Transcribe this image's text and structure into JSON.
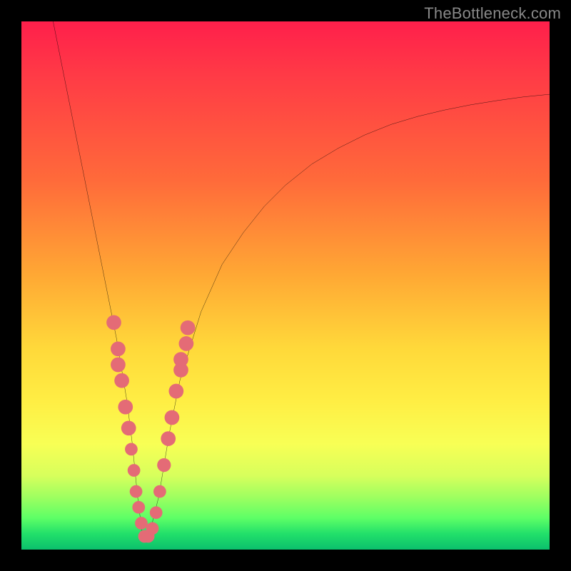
{
  "watermark": "TheBottleneck.com",
  "chart_data": {
    "type": "line",
    "title": "",
    "xlabel": "",
    "ylabel": "",
    "xlim": [
      0,
      100
    ],
    "ylim": [
      0,
      100
    ],
    "series": [
      {
        "name": "bottleneck-curve",
        "x": [
          6,
          8,
          10,
          12,
          14,
          16,
          18,
          20,
          21,
          22,
          23,
          24,
          26,
          28,
          30,
          34,
          38,
          42,
          46,
          50,
          55,
          60,
          65,
          70,
          75,
          80,
          85,
          90,
          95,
          100
        ],
        "values": [
          100,
          90,
          80,
          70,
          60,
          50,
          40,
          28,
          20,
          10,
          2,
          2,
          10,
          22,
          32,
          45,
          54,
          60,
          65,
          69,
          73,
          76,
          78.5,
          80.5,
          82,
          83.2,
          84.2,
          85,
          85.7,
          86.2
        ]
      }
    ],
    "markers": {
      "name": "highlighted-points",
      "color": "#e46b76",
      "points": [
        {
          "x": 17.5,
          "y": 43,
          "r": 1.4
        },
        {
          "x": 18.3,
          "y": 38,
          "r": 1.4
        },
        {
          "x": 18.3,
          "y": 35,
          "r": 1.4
        },
        {
          "x": 19.0,
          "y": 32,
          "r": 1.4
        },
        {
          "x": 19.7,
          "y": 27,
          "r": 1.4
        },
        {
          "x": 20.3,
          "y": 23,
          "r": 1.4
        },
        {
          "x": 20.8,
          "y": 19,
          "r": 1.2
        },
        {
          "x": 21.3,
          "y": 15,
          "r": 1.2
        },
        {
          "x": 21.7,
          "y": 11,
          "r": 1.2
        },
        {
          "x": 22.2,
          "y": 8,
          "r": 1.2
        },
        {
          "x": 22.7,
          "y": 5,
          "r": 1.2
        },
        {
          "x": 23.3,
          "y": 2.5,
          "r": 1.2
        },
        {
          "x": 24.0,
          "y": 2.5,
          "r": 1.2
        },
        {
          "x": 24.8,
          "y": 4,
          "r": 1.2
        },
        {
          "x": 25.5,
          "y": 7,
          "r": 1.2
        },
        {
          "x": 26.2,
          "y": 11,
          "r": 1.2
        },
        {
          "x": 27.0,
          "y": 16,
          "r": 1.3
        },
        {
          "x": 27.8,
          "y": 21,
          "r": 1.4
        },
        {
          "x": 28.5,
          "y": 25,
          "r": 1.4
        },
        {
          "x": 29.3,
          "y": 30,
          "r": 1.4
        },
        {
          "x": 30.2,
          "y": 34,
          "r": 1.4
        },
        {
          "x": 30.2,
          "y": 36,
          "r": 1.4
        },
        {
          "x": 31.2,
          "y": 39,
          "r": 1.4
        },
        {
          "x": 31.5,
          "y": 42,
          "r": 1.4
        }
      ]
    }
  }
}
